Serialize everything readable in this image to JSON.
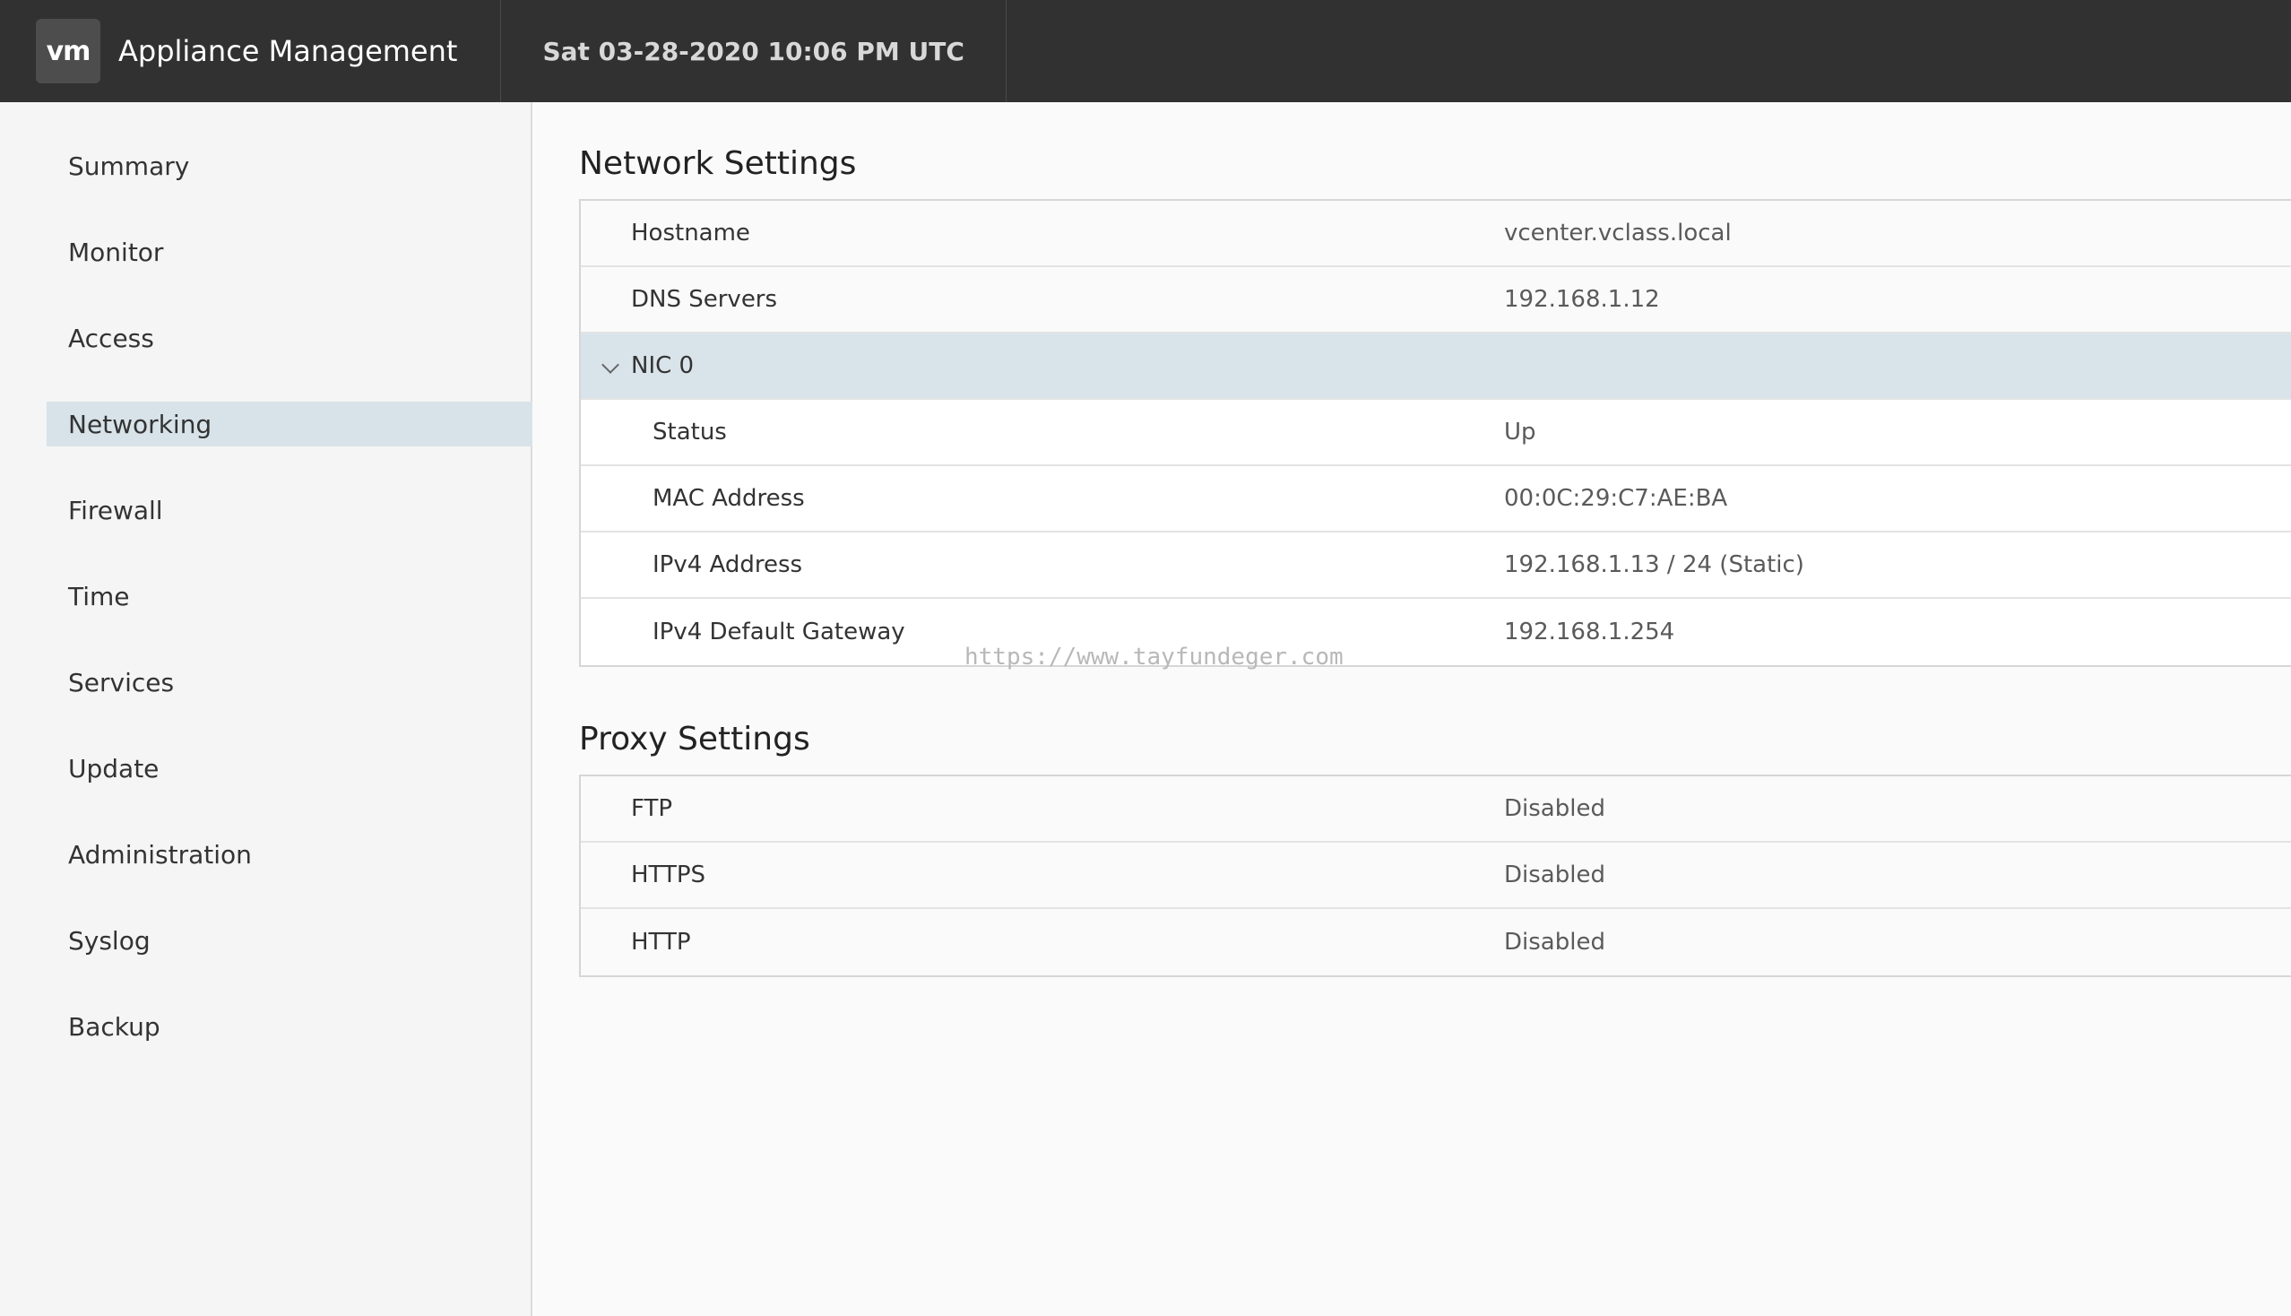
{
  "header": {
    "logo_text": "vm",
    "app_title": "Appliance Management",
    "datetime": "Sat 03-28-2020 10:06 PM UTC"
  },
  "sidebar": {
    "items": [
      {
        "label": "Summary"
      },
      {
        "label": "Monitor"
      },
      {
        "label": "Access"
      },
      {
        "label": "Networking",
        "active": true
      },
      {
        "label": "Firewall"
      },
      {
        "label": "Time"
      },
      {
        "label": "Services"
      },
      {
        "label": "Update"
      },
      {
        "label": "Administration"
      },
      {
        "label": "Syslog"
      },
      {
        "label": "Backup"
      }
    ]
  },
  "network": {
    "title": "Network Settings",
    "rows": {
      "hostname": {
        "label": "Hostname",
        "value": "vcenter.vclass.local"
      },
      "dns": {
        "label": "DNS Servers",
        "value": "192.168.1.12"
      },
      "nic": {
        "label": "NIC 0"
      },
      "status": {
        "label": "Status",
        "value": "Up"
      },
      "mac": {
        "label": "MAC Address",
        "value": "00:0C:29:C7:AE:BA"
      },
      "ipv4": {
        "label": "IPv4 Address",
        "value": "192.168.1.13 / 24 (Static)"
      },
      "gateway": {
        "label": "IPv4 Default Gateway",
        "value": "192.168.1.254"
      }
    }
  },
  "proxy": {
    "title": "Proxy Settings",
    "rows": {
      "ftp": {
        "label": "FTP",
        "value": "Disabled"
      },
      "https": {
        "label": "HTTPS",
        "value": "Disabled"
      },
      "http": {
        "label": "HTTP",
        "value": "Disabled"
      }
    }
  },
  "watermark": "https://www.tayfundeger.com",
  "colors": {
    "header_bg": "#313131",
    "active_nav_bg": "#d8e3e9",
    "group_row_bg": "#d9e4ea"
  }
}
